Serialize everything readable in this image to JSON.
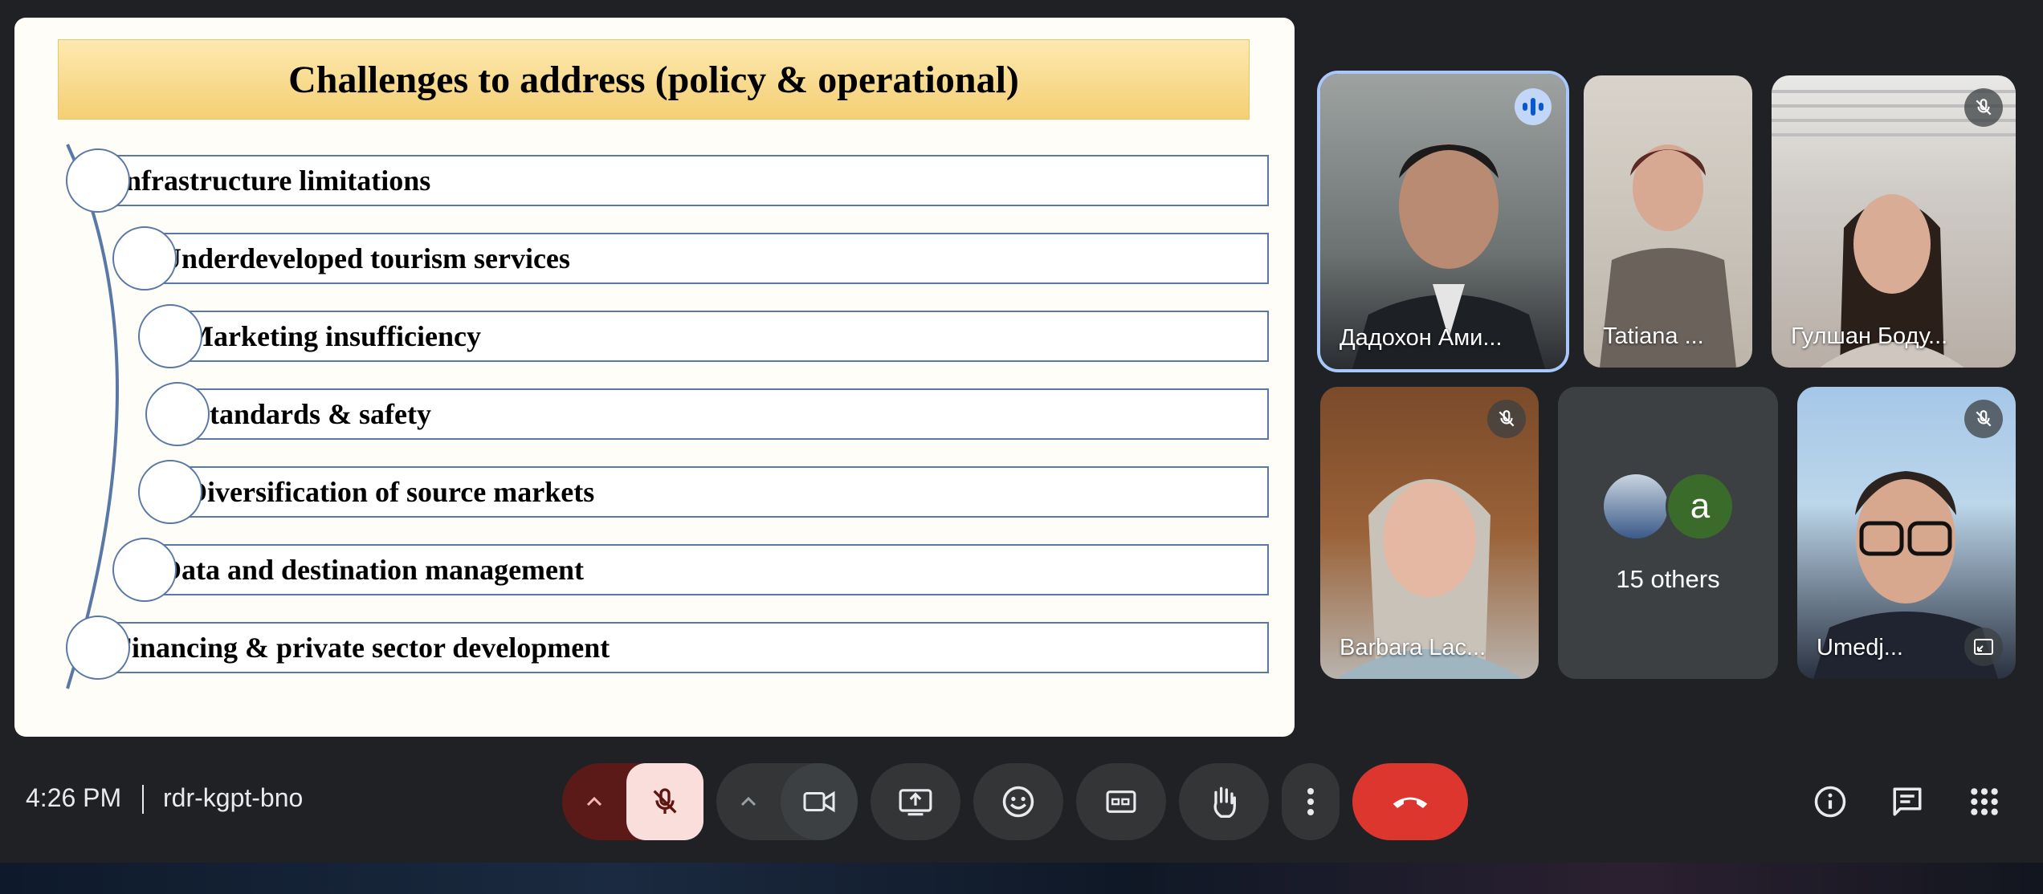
{
  "slide": {
    "title": "Challenges to address (policy & operational)",
    "items": [
      {
        "label": "Infrastructure limitations"
      },
      {
        "label": "Underdeveloped tourism services"
      },
      {
        "label": "Marketing insufficiency"
      },
      {
        "label": "Standards & safety"
      },
      {
        "label": "Diversification of source markets"
      },
      {
        "label": "Data and destination management"
      },
      {
        "label": "Financing & private sector development"
      }
    ]
  },
  "participants": [
    {
      "name": "Дадохон Ами...",
      "status": "speaking"
    },
    {
      "name": "Tatiana ...",
      "status": "active"
    },
    {
      "name": "Гулшан Боду...",
      "status": "muted"
    },
    {
      "name": "Barbara Lac...",
      "status": "muted"
    },
    {
      "name": "Umedj...",
      "status": "muted"
    }
  ],
  "others_tile": {
    "avatar_letter": "a",
    "label": "15 others"
  },
  "meeting": {
    "time": "4:26 PM",
    "code": "rdr-kgpt-bno"
  },
  "controls": {
    "mic_options": "chevron-up-icon",
    "mic": "mic-off-icon",
    "camera_options": "chevron-up-icon",
    "camera": "videocam-icon",
    "present": "present-to-all-icon",
    "reactions": "emoji-icon",
    "captions": "closed-caption-icon",
    "raise_hand": "hand-icon",
    "more": "more-vert-icon",
    "leave": "call-end-icon",
    "info": "info-icon",
    "chat": "chat-icon",
    "activities": "apps-grid-icon"
  },
  "colors": {
    "accent": "#a8c7fa",
    "leave": "#dc362e",
    "mic_muted_bg": "#f9dedc",
    "mic_group": "#5b1a17"
  }
}
